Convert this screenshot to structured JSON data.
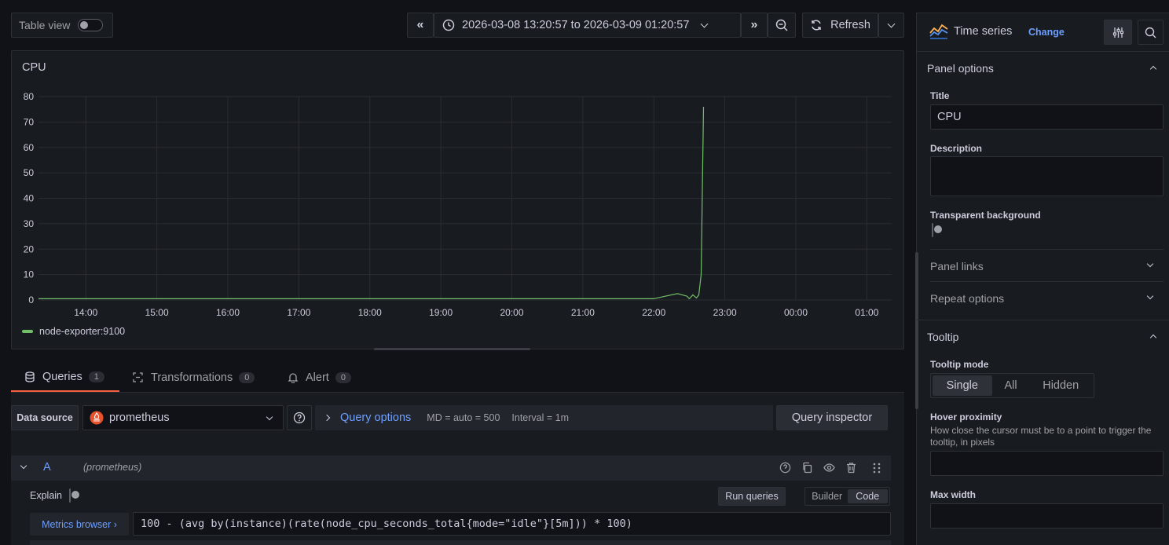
{
  "toolbar": {
    "table_view_label": "Table view",
    "time_range": "2026-03-08 13:20:57 to 2026-03-09 01:20:57",
    "refresh_label": "Refresh"
  },
  "panel": {
    "title": "CPU",
    "legend": "node-exporter:9100"
  },
  "chart_data": {
    "type": "line",
    "x": [
      "13:20",
      "13:40",
      "14:00",
      "15:00",
      "16:00",
      "17:00",
      "18:00",
      "19:00",
      "20:00",
      "21:00",
      "22:00",
      "22:10",
      "22:20",
      "22:28",
      "22:30",
      "22:33",
      "22:36",
      "22:38",
      "22:40",
      "22:42"
    ],
    "series": [
      {
        "name": "node-exporter:9100",
        "values": [
          0.5,
          0.5,
          0.5,
          0.5,
          0.5,
          0.5,
          0.5,
          0.5,
          0.5,
          0.5,
          0.5,
          1.5,
          2.5,
          1.5,
          0.5,
          2,
          0.8,
          2,
          10,
          76
        ]
      }
    ],
    "x_ticks": [
      "14:00",
      "15:00",
      "16:00",
      "17:00",
      "18:00",
      "19:00",
      "20:00",
      "21:00",
      "22:00",
      "23:00",
      "00:00",
      "01:00"
    ],
    "y_ticks": [
      "0",
      "10",
      "20",
      "30",
      "40",
      "50",
      "60",
      "70",
      "80"
    ],
    "ylim": [
      0,
      80
    ],
    "grid": true,
    "legend_position": "bottom-left",
    "colors": {
      "line": "#73bf69"
    }
  },
  "tabs": [
    {
      "label": "Queries",
      "count": "1"
    },
    {
      "label": "Transformations",
      "count": "0"
    },
    {
      "label": "Alert",
      "count": "0"
    }
  ],
  "datasource": {
    "label": "Data source",
    "value": "prometheus",
    "query_options_label": "Query options",
    "md": "MD = auto = 500",
    "interval": "Interval = 1m",
    "inspector_label": "Query inspector"
  },
  "query": {
    "ref_id": "A",
    "source": "(prometheus)",
    "explain_label": "Explain",
    "run_label": "Run queries",
    "builder_label": "Builder",
    "code_label": "Code",
    "metrics_browser_label": "Metrics browser ›",
    "expr": "100 - (avg by(instance)(rate(node_cpu_seconds_total{mode=\"idle\"}[5m])) * 100)"
  },
  "sidebar": {
    "viz_name": "Time series",
    "change_label": "Change",
    "panel_options_title": "Panel options",
    "title_label": "Title",
    "title_value": "CPU",
    "description_label": "Description",
    "transparent_label": "Transparent background",
    "panel_links_label": "Panel links",
    "repeat_options_label": "Repeat options",
    "tooltip_title": "Tooltip",
    "tooltip_mode_label": "Tooltip mode",
    "tooltip_modes": [
      "Single",
      "All",
      "Hidden"
    ],
    "hover_proximity_label": "Hover proximity",
    "hover_proximity_desc": "How close the cursor must be to a point to trigger the tooltip, in pixels",
    "max_width_label": "Max width"
  }
}
